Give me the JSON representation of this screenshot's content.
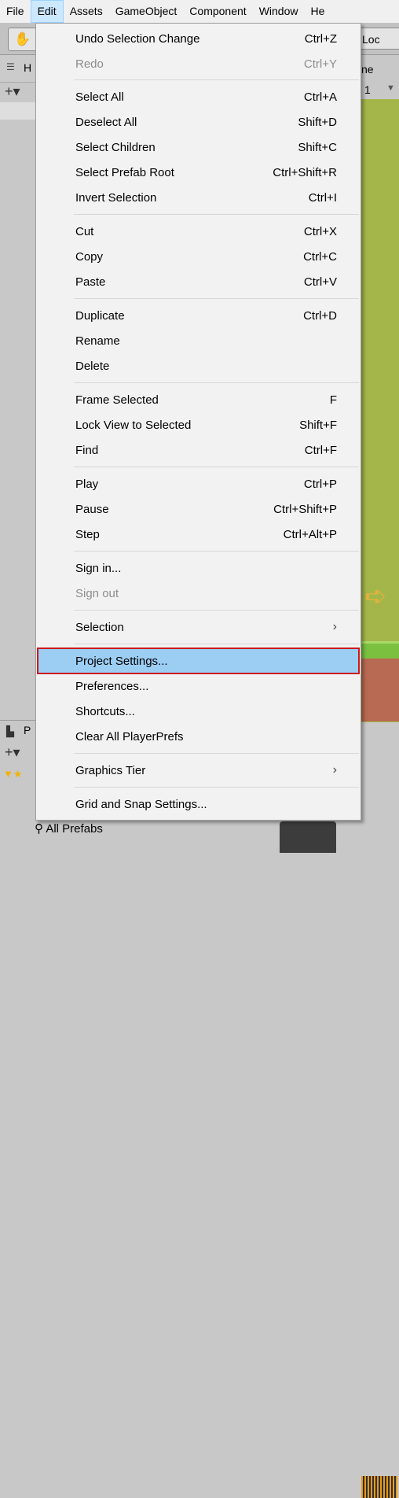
{
  "menubar": {
    "items": [
      "File",
      "Edit",
      "Assets",
      "GameObject",
      "Component",
      "Window",
      "He"
    ]
  },
  "toolbar": {
    "hand_tool_icon": "hand-icon",
    "lock_label": "Loc"
  },
  "hierarchy": {
    "tab_label": "H",
    "add_label": "+▾"
  },
  "scene": {
    "tab_label": "ne",
    "zoom_value": "1"
  },
  "project": {
    "tab_label": "P",
    "add_label": "+▾",
    "search_label": "All Prefabs"
  },
  "edit_menu": {
    "undo": {
      "label": "Undo Selection Change",
      "shortcut": "Ctrl+Z"
    },
    "redo": {
      "label": "Redo",
      "shortcut": "Ctrl+Y"
    },
    "select_all": {
      "label": "Select All",
      "shortcut": "Ctrl+A"
    },
    "deselect_all": {
      "label": "Deselect All",
      "shortcut": "Shift+D"
    },
    "select_children": {
      "label": "Select Children",
      "shortcut": "Shift+C"
    },
    "select_prefab_root": {
      "label": "Select Prefab Root",
      "shortcut": "Ctrl+Shift+R"
    },
    "invert_selection": {
      "label": "Invert Selection",
      "shortcut": "Ctrl+I"
    },
    "cut": {
      "label": "Cut",
      "shortcut": "Ctrl+X"
    },
    "copy": {
      "label": "Copy",
      "shortcut": "Ctrl+C"
    },
    "paste": {
      "label": "Paste",
      "shortcut": "Ctrl+V"
    },
    "duplicate": {
      "label": "Duplicate",
      "shortcut": "Ctrl+D"
    },
    "rename": {
      "label": "Rename",
      "shortcut": ""
    },
    "delete": {
      "label": "Delete",
      "shortcut": ""
    },
    "frame_selected": {
      "label": "Frame Selected",
      "shortcut": "F"
    },
    "lock_view": {
      "label": "Lock View to Selected",
      "shortcut": "Shift+F"
    },
    "find": {
      "label": "Find",
      "shortcut": "Ctrl+F"
    },
    "play": {
      "label": "Play",
      "shortcut": "Ctrl+P"
    },
    "pause": {
      "label": "Pause",
      "shortcut": "Ctrl+Shift+P"
    },
    "step": {
      "label": "Step",
      "shortcut": "Ctrl+Alt+P"
    },
    "sign_in": {
      "label": "Sign in...",
      "shortcut": ""
    },
    "sign_out": {
      "label": "Sign out",
      "shortcut": ""
    },
    "selection": {
      "label": "Selection",
      "arrow": "›"
    },
    "project_settings": {
      "label": "Project Settings...",
      "shortcut": ""
    },
    "preferences": {
      "label": "Preferences...",
      "shortcut": ""
    },
    "shortcuts": {
      "label": "Shortcuts...",
      "shortcut": ""
    },
    "clear_playerprefs": {
      "label": "Clear All PlayerPrefs",
      "shortcut": ""
    },
    "graphics_tier": {
      "label": "Graphics Tier",
      "arrow": "›"
    },
    "grid_snap": {
      "label": "Grid and Snap Settings...",
      "shortcut": ""
    }
  },
  "colors": {
    "highlight_fill": "#9ccdf3",
    "highlight_border": "#cc1a1a",
    "active_menu": "#cce8ff"
  }
}
